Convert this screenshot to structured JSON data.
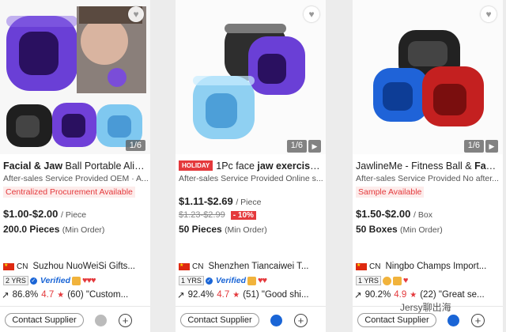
{
  "cards": [
    {
      "image_counter": "1/6",
      "has_play": false,
      "holiday": "",
      "title_bold": "Facial & Jaw",
      "title_rest": " Ball Portable Align...",
      "service": "After-sales Service Provided OEM · A...",
      "tag": "Centralized Procurement Available",
      "price": "$1.00-$2.00",
      "price_unit": "/ Piece",
      "orig_price": "",
      "discount": "",
      "moq": "200.0 Pieces",
      "moq_note": "(Min Order)",
      "country": "CN",
      "supplier": "Suzhou NuoWeiSi Gifts...",
      "years": "2 YRS",
      "verified": "Verified",
      "response_rate": "86.8%",
      "rating": "4.7",
      "review": "(60) \"Custom...",
      "contact_label": "Contact Supplier"
    },
    {
      "image_counter": "1/6",
      "has_play": true,
      "holiday": "HOLIDAY",
      "title_pre": "1Pc face ",
      "title_bold": "jaw exerciser",
      "title_rest": "...",
      "service": "After-sales Service Provided Online s...",
      "tag": "",
      "price": "$1.11-$2.69",
      "price_unit": "/ Piece",
      "orig_price": "$1.23-$2.99",
      "discount": "- 10%",
      "moq": "50 Pieces",
      "moq_note": "(Min Order)",
      "country": "CN",
      "supplier": "Shenzhen Tiancaiwei T...",
      "years": "1 YRS",
      "verified": "Verified",
      "response_rate": "92.4%",
      "rating": "4.7",
      "review": "(51) \"Good shi...",
      "contact_label": "Contact Supplier"
    },
    {
      "image_counter": "1/6",
      "has_play": true,
      "holiday": "",
      "title_pre": "JawlineMe - Fitness Ball & ",
      "title_bold": "Faci",
      "title_rest": "...",
      "service": "After-sales Service Provided No after...",
      "tag": "Sample Available",
      "price": "$1.50-$2.00",
      "price_unit": "/ Box",
      "orig_price": "",
      "discount": "",
      "moq": "50 Boxes",
      "moq_note": "(Min Order)",
      "country": "CN",
      "supplier": "Ningbo Champs Import...",
      "years": "1 YRS",
      "verified": "",
      "response_rate": "90.2%",
      "rating": "4.9",
      "review": "(22) \"Great se...",
      "contact_label": "Contact Supplier"
    }
  ],
  "watermark": "Jersy聊出海",
  "colors": {
    "accent": "#e4393c",
    "verified_blue": "#1a65d6",
    "tag_bg": "#fdeceb"
  },
  "icons": [
    "heart-icon",
    "play-icon",
    "flag-cn-icon",
    "medal-icon",
    "chat-icon",
    "plus-circle-icon",
    "share-arrow-icon",
    "star-icon"
  ]
}
